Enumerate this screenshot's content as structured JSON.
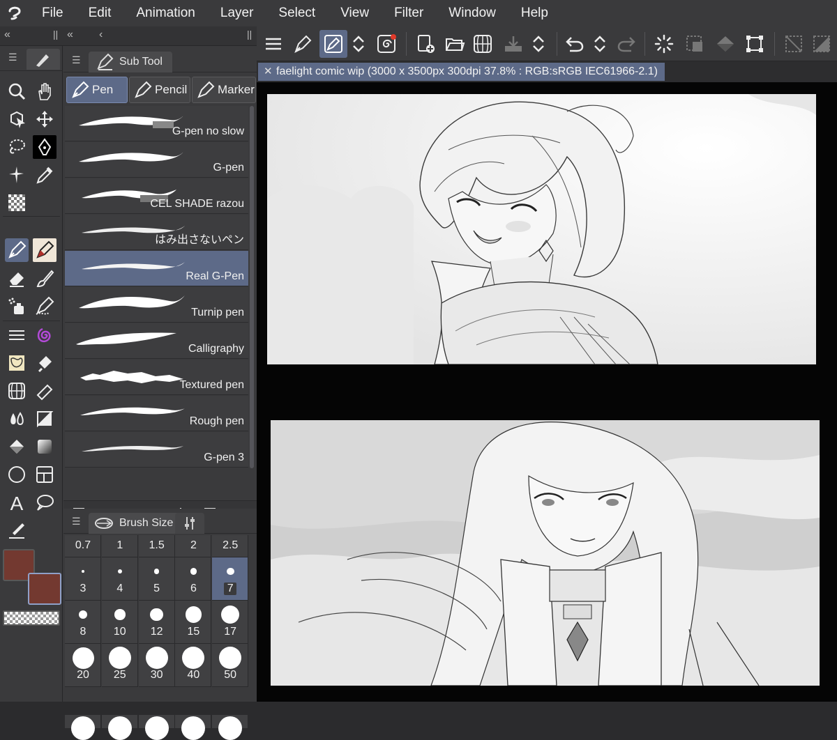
{
  "menu": [
    "File",
    "Edit",
    "Animation",
    "Layer",
    "Select",
    "View",
    "Filter",
    "Window",
    "Help"
  ],
  "subtool": {
    "tab_label": "Sub Tool",
    "categories": [
      "Pen",
      "Pencil",
      "Marker"
    ],
    "brushes": [
      "G-pen no slow",
      "G-pen",
      "CEL SHADE razou",
      "はみ出さないペン",
      "Real G-Pen",
      "Turnip pen",
      "Calligraphy",
      "Textured pen",
      "Rough pen",
      "G-pen 3"
    ],
    "selected_brush": "Real G-Pen"
  },
  "brush_size": {
    "tab_label": "Brush Size",
    "sizes": [
      "0.7",
      "1",
      "1.5",
      "2",
      "2.5",
      "3",
      "4",
      "5",
      "6",
      "7",
      "8",
      "10",
      "12",
      "15",
      "17",
      "20",
      "25",
      "30",
      "40",
      "50"
    ],
    "selected": "7"
  },
  "document": {
    "tab_title": "faelight comic wip (3000 x 3500px 300dpi 37.8% : RGB:sRGB IEC61966-2.1)"
  },
  "colors": {
    "main_color": "#733930",
    "sub_color": "#733930",
    "accent_selection": "#5d6a88"
  }
}
